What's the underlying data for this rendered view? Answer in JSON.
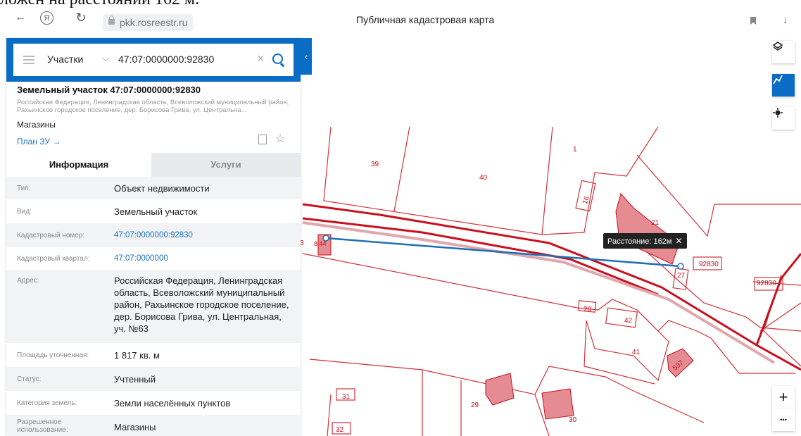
{
  "top_caption": "ложен на расстоянии 162 м.",
  "browser": {
    "url": "pkk.rosreestr.ru",
    "title": "Публичная кадастровая карта",
    "back_glyph": "←",
    "yandex_glyph": "Я",
    "reload_glyph": "↻",
    "download_glyph": "↓"
  },
  "search": {
    "type": "Участки",
    "value": "47:07:0000000:92830",
    "clear_glyph": "×",
    "collapse_glyph": "‹"
  },
  "parcel": {
    "title": "Земельный участок 47:07:0000000:92830",
    "address_short": "Российская Федерация, Ленинградская область, Всеволожский муниципальный район, Рахьинское городское поселение, дер. Борисова Грива, ул. Центральна...",
    "use": "Магазины",
    "plan_link": "План ЗУ →",
    "star_glyph": "☆"
  },
  "tabs": {
    "info": "Информация",
    "services": "Услуги"
  },
  "info_rows": [
    {
      "key": "Тип:",
      "value": "Объект недвижимости",
      "link": false
    },
    {
      "key": "Вид:",
      "value": "Земельный участок",
      "link": false
    },
    {
      "key": "Кадастровый номер:",
      "value": "47:07:0000000:92830",
      "link": true
    },
    {
      "key": "Кадастровый квартал:",
      "value": "47:07:0000000",
      "link": true
    },
    {
      "key": "Адрес:",
      "value": "Российская Федерация, Ленинградская область, Всеволожский муниципальный район, Рахьинское городское поселение, дер. Борисова Грива, ул. Центральная, уч. №63",
      "link": false
    },
    {
      "key": "Площадь уточненная:",
      "value": "1 817 кв. м",
      "link": false
    },
    {
      "key": "Статус:",
      "value": "Учтенный",
      "link": false
    },
    {
      "key": "Категория земель:",
      "value": "Земли населённых пунктов",
      "link": false
    },
    {
      "key": "Разрешенное использование:",
      "value": "Магазины",
      "link": false
    }
  ],
  "map": {
    "measure_label": "Расстояние: 162м",
    "measure_close": "✕",
    "zoom_in": "+",
    "more": "•••",
    "labels": [
      "39",
      "1",
      "40",
      "16",
      "21",
      "92830",
      "92830",
      "27",
      "28",
      "42",
      "41",
      "537",
      "31",
      "29",
      "30",
      "32",
      "3",
      "8:44"
    ],
    "colors": {
      "parcel_line": "#d0323c",
      "thick_line": "#c8101e",
      "building": "#e58c92",
      "measure": "#1f6fb5",
      "accent": "#0b6cc6"
    }
  }
}
